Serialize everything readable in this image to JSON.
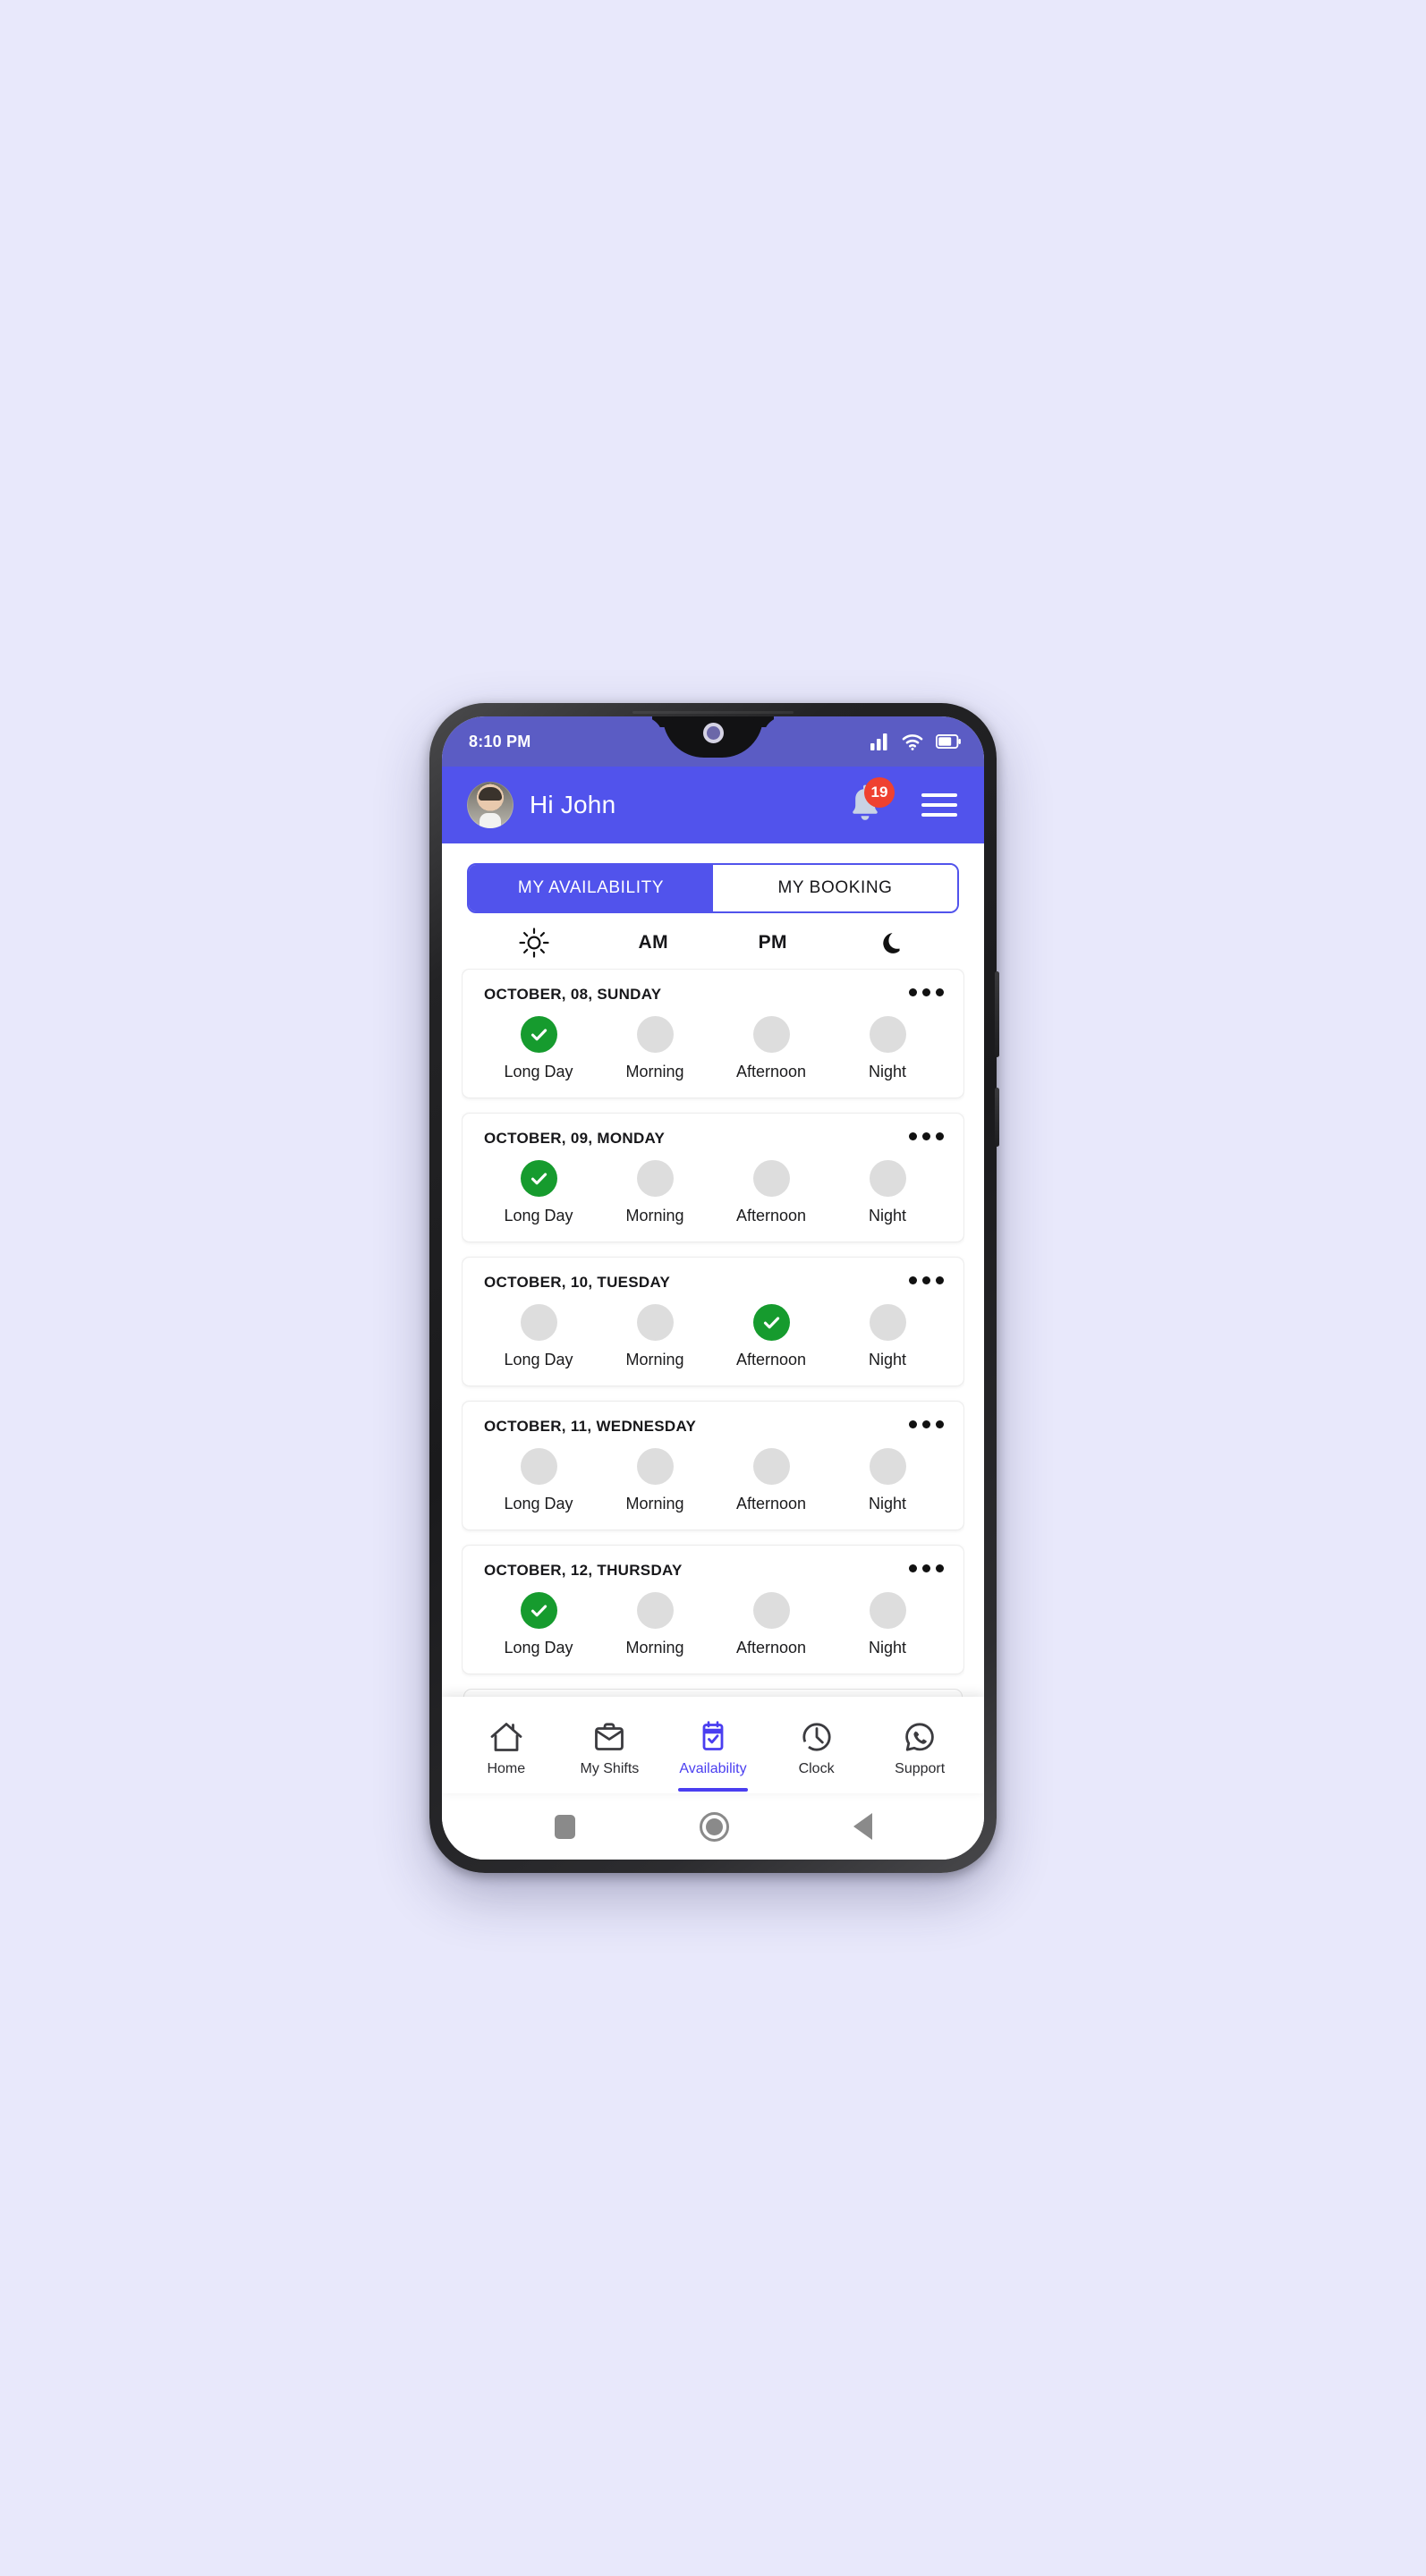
{
  "status_bar": {
    "time": "8:10 PM",
    "icons": [
      "signal-icon",
      "wifi-icon",
      "battery-icon"
    ]
  },
  "header": {
    "greeting": "Hi John",
    "avatar": "user-avatar",
    "notification_icon": "bell-icon",
    "notification_count": "19",
    "menu_icon": "hamburger-menu-icon"
  },
  "tabs": {
    "items": [
      {
        "label": "MY AVAILABILITY",
        "active": true
      },
      {
        "label": "MY BOOKING",
        "active": false
      }
    ]
  },
  "shift_header": {
    "cells": [
      {
        "type": "icon",
        "icon": "sun-icon",
        "label": ""
      },
      {
        "type": "text",
        "icon": "",
        "label": "AM"
      },
      {
        "type": "text",
        "icon": "",
        "label": "PM"
      },
      {
        "type": "icon",
        "icon": "moon-icon",
        "label": ""
      }
    ]
  },
  "days": [
    {
      "date": "OCTOBER, 08, SUNDAY",
      "menu_icon": "more-options-icon",
      "slots": [
        {
          "label": "Long Day",
          "selected": true
        },
        {
          "label": "Morning",
          "selected": false
        },
        {
          "label": "Afternoon",
          "selected": false
        },
        {
          "label": "Night",
          "selected": false
        }
      ]
    },
    {
      "date": "OCTOBER, 09, MONDAY",
      "menu_icon": "more-options-icon",
      "slots": [
        {
          "label": "Long Day",
          "selected": true
        },
        {
          "label": "Morning",
          "selected": false
        },
        {
          "label": "Afternoon",
          "selected": false
        },
        {
          "label": "Night",
          "selected": false
        }
      ]
    },
    {
      "date": "OCTOBER, 10, TUESDAY",
      "menu_icon": "more-options-icon",
      "slots": [
        {
          "label": "Long Day",
          "selected": false
        },
        {
          "label": "Morning",
          "selected": false
        },
        {
          "label": "Afternoon",
          "selected": true
        },
        {
          "label": "Night",
          "selected": false
        }
      ]
    },
    {
      "date": "OCTOBER, 11, WEDNESDAY",
      "menu_icon": "more-options-icon",
      "slots": [
        {
          "label": "Long Day",
          "selected": false
        },
        {
          "label": "Morning",
          "selected": false
        },
        {
          "label": "Afternoon",
          "selected": false
        },
        {
          "label": "Night",
          "selected": false
        }
      ]
    },
    {
      "date": "OCTOBER, 12, THURSDAY",
      "menu_icon": "more-options-icon",
      "slots": [
        {
          "label": "Long Day",
          "selected": true
        },
        {
          "label": "Morning",
          "selected": false
        },
        {
          "label": "Afternoon",
          "selected": false
        },
        {
          "label": "Night",
          "selected": false
        }
      ]
    }
  ],
  "bottom_nav": [
    {
      "label": "Home",
      "icon": "home-icon",
      "active": false
    },
    {
      "label": "My Shifts",
      "icon": "briefcase-icon",
      "active": false
    },
    {
      "label": "Availability",
      "icon": "calendar-check-icon",
      "active": true
    },
    {
      "label": "Clock",
      "icon": "clock-icon",
      "active": false
    },
    {
      "label": "Support",
      "icon": "whatsapp-phone-icon",
      "active": false
    }
  ],
  "android_keys": [
    {
      "icon": "recents-square-icon"
    },
    {
      "icon": "home-circle-icon"
    },
    {
      "icon": "back-triangle-icon"
    }
  ],
  "colors": {
    "brand_purple": "#5153ec",
    "status_purple": "#5b5cc4",
    "selected_green": "#169b2e",
    "badge_red": "#ef4130",
    "nav_active": "#4a3ef0",
    "page_background": "#e8e8fb"
  }
}
